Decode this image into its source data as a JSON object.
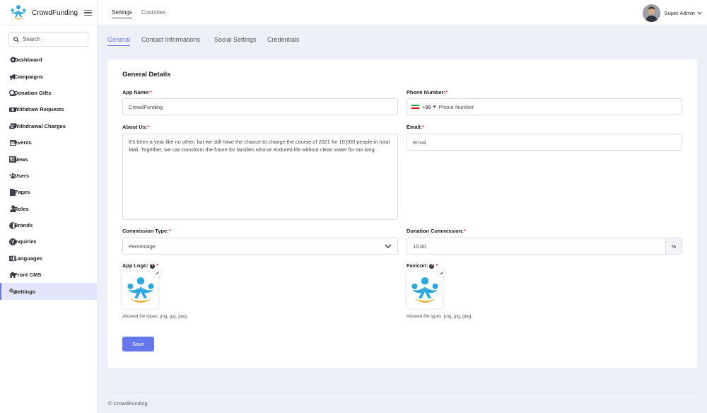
{
  "brand": {
    "name": "CrowdFunding"
  },
  "search": {
    "placeholder": "Search"
  },
  "sidebar": {
    "items": [
      {
        "label": "Dashboard",
        "icon": "dashboard-icon"
      },
      {
        "label": "Campaigns",
        "icon": "megaphone-icon"
      },
      {
        "label": "Donation Gifts",
        "icon": "gift-icon"
      },
      {
        "label": "Withdraw Requests",
        "icon": "money-icon"
      },
      {
        "label": "Withdrawal Charges",
        "icon": "money-stack-icon"
      },
      {
        "label": "Events",
        "icon": "calendar-icon"
      },
      {
        "label": "News",
        "icon": "newspaper-icon"
      },
      {
        "label": "Users",
        "icon": "users-icon"
      },
      {
        "label": "Pages",
        "icon": "page-icon"
      },
      {
        "label": "Roles",
        "icon": "user-icon"
      },
      {
        "label": "Brands",
        "icon": "half-circle-icon"
      },
      {
        "label": "Inquiries",
        "icon": "question-icon"
      },
      {
        "label": "Languages",
        "icon": "language-icon"
      },
      {
        "label": "Front CMS",
        "icon": "home-icon"
      },
      {
        "label": "Settings",
        "icon": "cogs-icon",
        "active": true
      }
    ]
  },
  "topbar": {
    "tabs": [
      {
        "label": "Settings",
        "active": true
      },
      {
        "label": "Countries",
        "active": false
      }
    ],
    "user_name": "Super Admin"
  },
  "subtabs": [
    {
      "label": "General",
      "active": true
    },
    {
      "label": "Contact Informations",
      "active": false
    },
    {
      "label": "Social Settings",
      "active": false
    },
    {
      "label": "Credentials",
      "active": false
    }
  ],
  "form": {
    "title": "General Details",
    "app_name": {
      "label": "App Name:",
      "value": "CrowdFunding"
    },
    "phone": {
      "label": "Phone Number:",
      "dial_code": "+98",
      "placeholder": "Phone Number"
    },
    "about": {
      "label": "About Us:",
      "value": "It's been a year like no other, but we still have the chance to change the course of 2021 for 10,000 people in rural Mali. Together, we can transform the future for families who've endured life without clean water for too long."
    },
    "email": {
      "label": "Email:",
      "placeholder": "Email"
    },
    "commission_type": {
      "label": "Commission Type:",
      "value": "Percentage"
    },
    "donation_commission": {
      "label": "Donation Commission:",
      "value": "10.00",
      "unit": "%"
    },
    "app_logo": {
      "label": "App Logo:",
      "hint": "Allowed file types: png, jpg, jpeg."
    },
    "favicon": {
      "label": "Favicon:",
      "hint": "Allowed file types: png, jpg, jpeg."
    },
    "save_label": "Save"
  },
  "footer": {
    "text": "© CrowdFunding"
  },
  "colors": {
    "accent": "#6577ee",
    "logo_blue": "#2aa8e0",
    "logo_orange": "#f4a11d",
    "required": "#e0303a"
  }
}
